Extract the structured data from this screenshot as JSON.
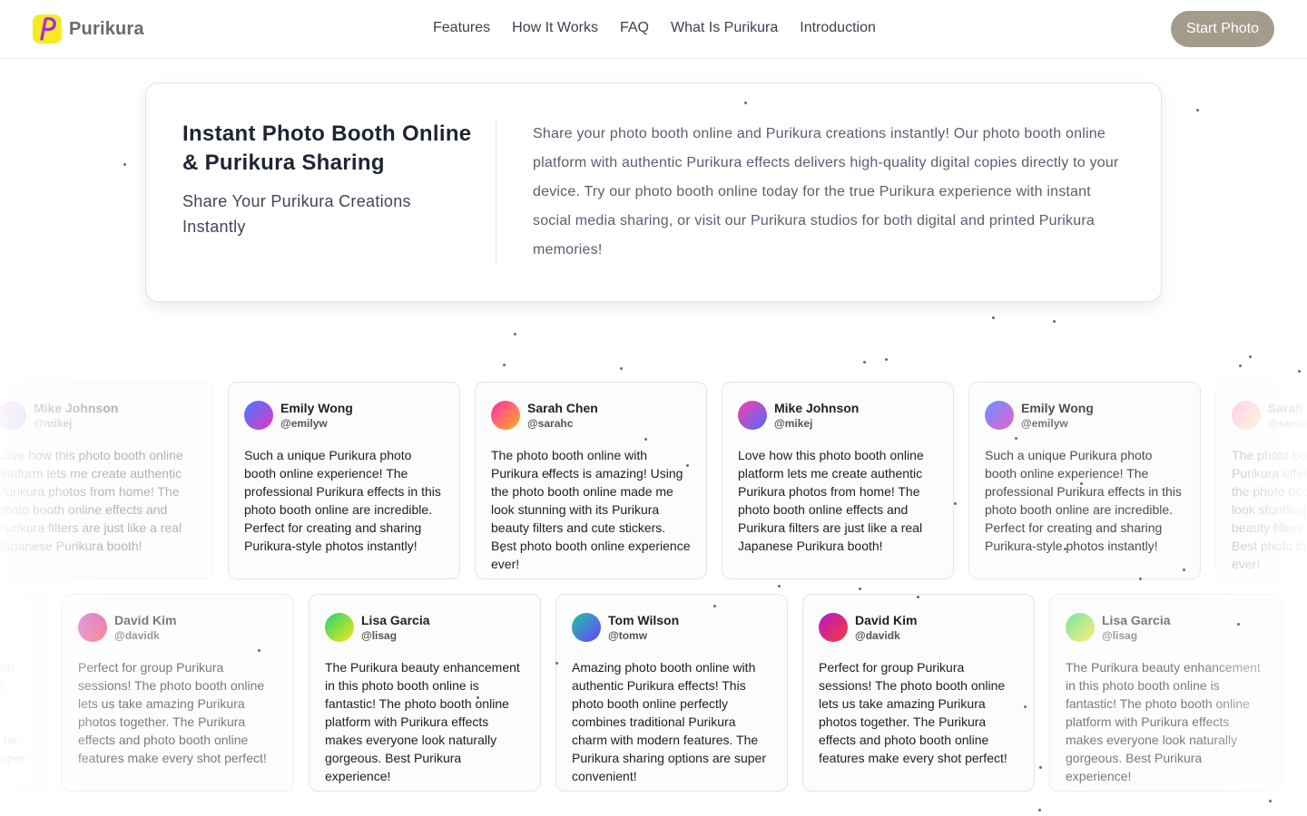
{
  "brand": {
    "name": "Purikura",
    "logo_letter": "P",
    "logo_color": "#f7ea22"
  },
  "nav": {
    "links": [
      "Features",
      "How It Works",
      "FAQ",
      "What Is Purikura",
      "Introduction"
    ],
    "cta_label": "Start Photo",
    "cta_color": "#a39c8a"
  },
  "hero": {
    "title": "Instant Photo Booth Online & Purikura Sharing",
    "subtitle": "Share Your Purikura Creations Instantly",
    "description": "Share your photo booth online and Purikura creations instantly! Our photo booth online platform with authentic Purikura effects delivers high-quality digital copies directly to your device. Try our photo booth online today for the true Purikura experience with instant social media sharing, or visit our Purikura studios for both digital and printed Purikura memories!"
  },
  "testimonials": {
    "row1": [
      {
        "name": "Mike Johnson",
        "handle": "@mikej",
        "text": "Love how this photo booth online platform lets me create authentic Purikura photos from home! The photo booth online effects and Purikura filters are just like a real Japanese Purikura booth!",
        "avatar_from": "#ff3ea5",
        "avatar_to": "#4b6bff"
      },
      {
        "name": "Emily Wong",
        "handle": "@emilyw",
        "text": "Such a unique Purikura photo booth online experience! The professional Purikura effects in this photo booth online are incredible. Perfect for creating and sharing Purikura-style photos instantly!",
        "avatar_from": "#3f7bff",
        "avatar_to": "#e834c6"
      },
      {
        "name": "Sarah Chen",
        "handle": "@sarahc",
        "text": "The photo booth online with Purikura effects is amazing! Using the photo booth online made me look stunning with its Purikura beauty filters and cute stickers. Best photo booth online experience ever!",
        "avatar_from": "#ff2bb0",
        "avatar_to": "#ffb11a"
      },
      {
        "name": "Mike Johnson",
        "handle": "@mikej",
        "text": "Love how this photo booth online platform lets me create authentic Purikura photos from home! The photo booth online effects and Purikura filters are just like a real Japanese Purikura booth!",
        "avatar_from": "#ff3ea5",
        "avatar_to": "#4b6bff"
      },
      {
        "name": "Emily Wong",
        "handle": "@emilyw",
        "text": "Such a unique Purikura photo booth online experience! The professional Purikura effects in this photo booth online are incredible. Perfect for creating and sharing Purikura-style photos instantly!",
        "avatar_from": "#3f7bff",
        "avatar_to": "#e834c6"
      },
      {
        "name": "Sarah Chen",
        "handle": "@sarahc",
        "text": "The photo booth online with Purikura effects is amazing! Using the photo booth online made me look stunning with its Purikura beauty filters and cute stickers. Best photo booth online experience ever!",
        "avatar_from": "#ff2bb0",
        "avatar_to": "#ffb11a"
      }
    ],
    "row2": [
      {
        "name": "Tom Wilson",
        "handle": "@tomw",
        "text": "Amazing photo booth online with authentic Purikura effects! This photo booth online perfectly combines traditional Purikura charm with modern features. The Purikura sharing options are super convenient!",
        "avatar_from": "#1fc9a4",
        "avatar_to": "#6a3cff"
      },
      {
        "name": "David Kim",
        "handle": "@davidk",
        "text": "Perfect for group Purikura sessions! The photo booth online lets us take amazing Purikura photos together. The Purikura effects and photo booth online features make every shot perfect!",
        "avatar_from": "#b01ac9",
        "avatar_to": "#ff3a3a"
      },
      {
        "name": "Lisa Garcia",
        "handle": "@lisag",
        "text": "The Purikura beauty enhancement in this photo booth online is fantastic! The photo booth online platform with Purikura effects makes everyone look naturally gorgeous. Best Purikura experience!",
        "avatar_from": "#21d46a",
        "avatar_to": "#f8e71c"
      },
      {
        "name": "Tom Wilson",
        "handle": "@tomw",
        "text": "Amazing photo booth online with authentic Purikura effects! This photo booth online perfectly combines traditional Purikura charm with modern features. The Purikura sharing options are super convenient!",
        "avatar_from": "#1fc9a4",
        "avatar_to": "#6a3cff"
      },
      {
        "name": "David Kim",
        "handle": "@davidk",
        "text": "Perfect for group Purikura sessions! The photo booth online lets us take amazing Purikura photos together. The Purikura effects and photo booth online features make every shot perfect!",
        "avatar_from": "#b01ac9",
        "avatar_to": "#ff3a3a"
      },
      {
        "name": "Lisa Garcia",
        "handle": "@lisag",
        "text": "The Purikura beauty enhancement in this photo booth online is fantastic! The photo booth online platform with Purikura effects makes everyone look naturally gorgeous. Best Purikura experience!",
        "avatar_from": "#21d46a",
        "avatar_to": "#f8e71c"
      }
    ]
  }
}
